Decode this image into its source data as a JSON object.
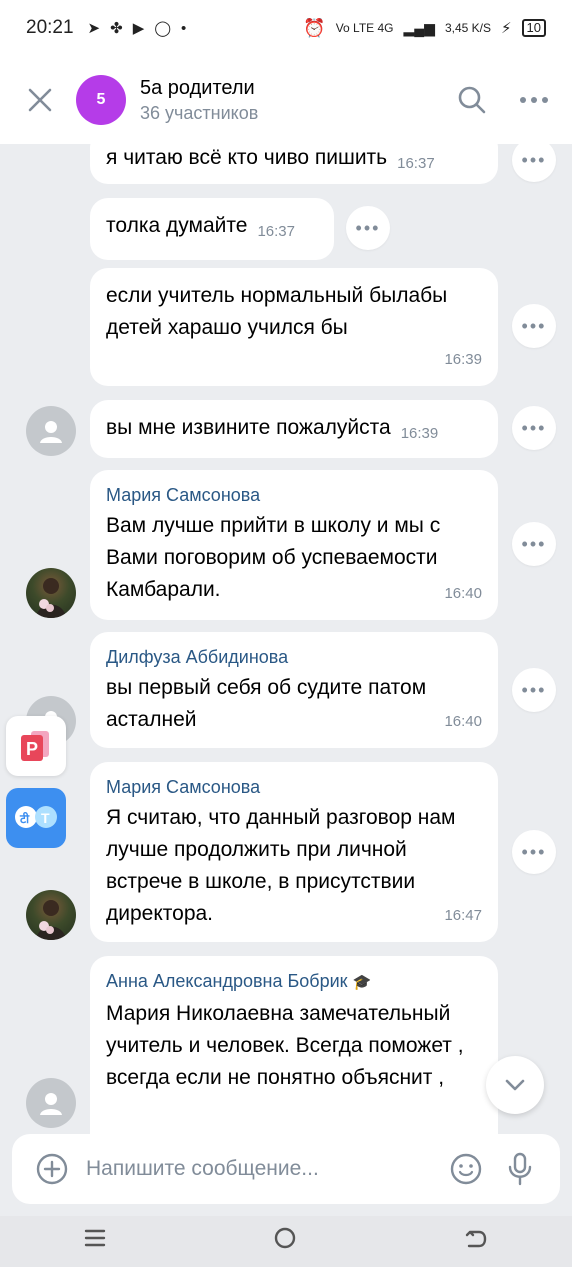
{
  "statusbar": {
    "time": "20:21",
    "network": "Vo LTE 4G",
    "speed": "3,45 K/S",
    "battery": "10"
  },
  "header": {
    "chat_avatar_text": "5",
    "chat_avatar_color": "#b53ce8",
    "title": "5а родители",
    "subtitle": "36 участников"
  },
  "messages": [
    {
      "text": "я читаю всё кто чиво пишить",
      "time": "16:37"
    },
    {
      "text": "толка думайте",
      "time": "16:37"
    },
    {
      "text": "если учитель нормальный былабы детей харашо учился бы",
      "time": "16:39"
    },
    {
      "text": "вы мне извините пожалуйста",
      "time": "16:39"
    },
    {
      "author": "Мария Самсонова",
      "text": "Вам лучше прийти в школу и мы с Вами поговорим об успеваемости Камбарали.",
      "time": "16:40"
    },
    {
      "author": "Дилфуза Аббидинова",
      "text": "вы первый себя об судите патом асталней",
      "time": "16:40"
    },
    {
      "author": "Мария Самсонова",
      "text": "Я считаю, что данный разговор нам лучше продолжить при личной встрече в школе, в присутствии директора.",
      "time": "16:47"
    },
    {
      "author": "Анна Александровна Бобрик",
      "text": "Мария Николаевна замечательный учитель и человек. Всегда поможет , всегда если не понятно объяснит ,"
    }
  ],
  "composer": {
    "placeholder": "Напишите сообщение..."
  },
  "colors": {
    "background": "#ebedf0",
    "author": "#2a5885",
    "secondary": "#818c99"
  }
}
